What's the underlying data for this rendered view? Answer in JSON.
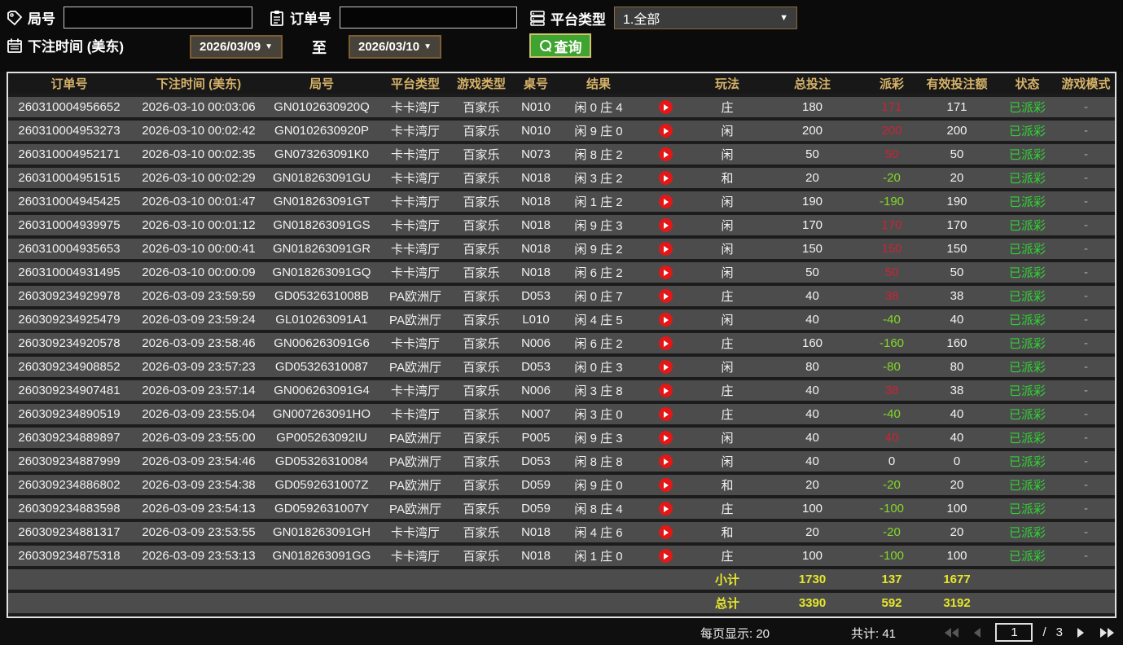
{
  "filters": {
    "round_label": "局号",
    "order_label": "订单号",
    "platform_label": "平台类型",
    "platform_value": "1.全部",
    "bet_time_label": "下注时间 (美东)",
    "date_from": "2026/03/09",
    "to_label": "至",
    "date_to": "2026/03/10",
    "search_label": "查询",
    "round_input_value": "",
    "order_input_value": ""
  },
  "icons": {
    "dropdown_arrow": "▼"
  },
  "table": {
    "columns": [
      "订单号",
      "下注时间 (美东)",
      "局号",
      "平台类型",
      "游戏类型",
      "桌号",
      "结果",
      "玩法",
      "总投注",
      "派彩",
      "有效投注额",
      "状态",
      "游戏模式"
    ],
    "rows": [
      {
        "order": "260310004956652",
        "time": "2026-03-10 00:03:06",
        "round": "GN0102630920Q",
        "platform": "卡卡湾厅",
        "game": "百家乐",
        "table": "N010",
        "result": "闲 0 庄 4",
        "play": "庄",
        "bet": "180",
        "payout": "171",
        "payout_class": "pos",
        "valid": "171",
        "status": "已派彩",
        "mode": "-"
      },
      {
        "order": "260310004953273",
        "time": "2026-03-10 00:02:42",
        "round": "GN0102630920P",
        "platform": "卡卡湾厅",
        "game": "百家乐",
        "table": "N010",
        "result": "闲 9 庄 0",
        "play": "闲",
        "bet": "200",
        "payout": "200",
        "payout_class": "pos",
        "valid": "200",
        "status": "已派彩",
        "mode": "-"
      },
      {
        "order": "260310004952171",
        "time": "2026-03-10 00:02:35",
        "round": "GN073263091K0",
        "platform": "卡卡湾厅",
        "game": "百家乐",
        "table": "N073",
        "result": "闲 8 庄 2",
        "play": "闲",
        "bet": "50",
        "payout": "50",
        "payout_class": "pos",
        "valid": "50",
        "status": "已派彩",
        "mode": "-"
      },
      {
        "order": "260310004951515",
        "time": "2026-03-10 00:02:29",
        "round": "GN018263091GU",
        "platform": "卡卡湾厅",
        "game": "百家乐",
        "table": "N018",
        "result": "闲 3 庄 2",
        "play": "和",
        "bet": "20",
        "payout": "-20",
        "payout_class": "neg",
        "valid": "20",
        "status": "已派彩",
        "mode": "-"
      },
      {
        "order": "260310004945425",
        "time": "2026-03-10 00:01:47",
        "round": "GN018263091GT",
        "platform": "卡卡湾厅",
        "game": "百家乐",
        "table": "N018",
        "result": "闲 1 庄 2",
        "play": "闲",
        "bet": "190",
        "payout": "-190",
        "payout_class": "neg",
        "valid": "190",
        "status": "已派彩",
        "mode": "-"
      },
      {
        "order": "260310004939975",
        "time": "2026-03-10 00:01:12",
        "round": "GN018263091GS",
        "platform": "卡卡湾厅",
        "game": "百家乐",
        "table": "N018",
        "result": "闲 9 庄 3",
        "play": "闲",
        "bet": "170",
        "payout": "170",
        "payout_class": "pos",
        "valid": "170",
        "status": "已派彩",
        "mode": "-"
      },
      {
        "order": "260310004935653",
        "time": "2026-03-10 00:00:41",
        "round": "GN018263091GR",
        "platform": "卡卡湾厅",
        "game": "百家乐",
        "table": "N018",
        "result": "闲 9 庄 2",
        "play": "闲",
        "bet": "150",
        "payout": "150",
        "payout_class": "pos",
        "valid": "150",
        "status": "已派彩",
        "mode": "-"
      },
      {
        "order": "260310004931495",
        "time": "2026-03-10 00:00:09",
        "round": "GN018263091GQ",
        "platform": "卡卡湾厅",
        "game": "百家乐",
        "table": "N018",
        "result": "闲 6 庄 2",
        "play": "闲",
        "bet": "50",
        "payout": "50",
        "payout_class": "pos",
        "valid": "50",
        "status": "已派彩",
        "mode": "-"
      },
      {
        "order": "260309234929978",
        "time": "2026-03-09 23:59:59",
        "round": "GD0532631008B",
        "platform": "PA欧洲厅",
        "game": "百家乐",
        "table": "D053",
        "result": "闲 0 庄 7",
        "play": "庄",
        "bet": "40",
        "payout": "38",
        "payout_class": "pos",
        "valid": "38",
        "status": "已派彩",
        "mode": "-"
      },
      {
        "order": "260309234925479",
        "time": "2026-03-09 23:59:24",
        "round": "GL010263091A1",
        "platform": "PA欧洲厅",
        "game": "百家乐",
        "table": "L010",
        "result": "闲 4 庄 5",
        "play": "闲",
        "bet": "40",
        "payout": "-40",
        "payout_class": "neg",
        "valid": "40",
        "status": "已派彩",
        "mode": "-"
      },
      {
        "order": "260309234920578",
        "time": "2026-03-09 23:58:46",
        "round": "GN006263091G6",
        "platform": "卡卡湾厅",
        "game": "百家乐",
        "table": "N006",
        "result": "闲 6 庄 2",
        "play": "庄",
        "bet": "160",
        "payout": "-160",
        "payout_class": "neg",
        "valid": "160",
        "status": "已派彩",
        "mode": "-"
      },
      {
        "order": "260309234908852",
        "time": "2026-03-09 23:57:23",
        "round": "GD05326310087",
        "platform": "PA欧洲厅",
        "game": "百家乐",
        "table": "D053",
        "result": "闲 0 庄 3",
        "play": "闲",
        "bet": "80",
        "payout": "-80",
        "payout_class": "neg",
        "valid": "80",
        "status": "已派彩",
        "mode": "-"
      },
      {
        "order": "260309234907481",
        "time": "2026-03-09 23:57:14",
        "round": "GN006263091G4",
        "platform": "卡卡湾厅",
        "game": "百家乐",
        "table": "N006",
        "result": "闲 3 庄 8",
        "play": "庄",
        "bet": "40",
        "payout": "38",
        "payout_class": "pos",
        "valid": "38",
        "status": "已派彩",
        "mode": "-"
      },
      {
        "order": "260309234890519",
        "time": "2026-03-09 23:55:04",
        "round": "GN007263091HO",
        "platform": "卡卡湾厅",
        "game": "百家乐",
        "table": "N007",
        "result": "闲 3 庄 0",
        "play": "庄",
        "bet": "40",
        "payout": "-40",
        "payout_class": "neg",
        "valid": "40",
        "status": "已派彩",
        "mode": "-"
      },
      {
        "order": "260309234889897",
        "time": "2026-03-09 23:55:00",
        "round": "GP005263092IU",
        "platform": "PA欧洲厅",
        "game": "百家乐",
        "table": "P005",
        "result": "闲 9 庄 3",
        "play": "闲",
        "bet": "40",
        "payout": "40",
        "payout_class": "pos",
        "valid": "40",
        "status": "已派彩",
        "mode": "-"
      },
      {
        "order": "260309234887999",
        "time": "2026-03-09 23:54:46",
        "round": "GD05326310084",
        "platform": "PA欧洲厅",
        "game": "百家乐",
        "table": "D053",
        "result": "闲 8 庄 8",
        "play": "闲",
        "bet": "40",
        "payout": "0",
        "payout_class": "zero",
        "valid": "0",
        "status": "已派彩",
        "mode": "-"
      },
      {
        "order": "260309234886802",
        "time": "2026-03-09 23:54:38",
        "round": "GD0592631007Z",
        "platform": "PA欧洲厅",
        "game": "百家乐",
        "table": "D059",
        "result": "闲 9 庄 0",
        "play": "和",
        "bet": "20",
        "payout": "-20",
        "payout_class": "neg",
        "valid": "20",
        "status": "已派彩",
        "mode": "-"
      },
      {
        "order": "260309234883598",
        "time": "2026-03-09 23:54:13",
        "round": "GD0592631007Y",
        "platform": "PA欧洲厅",
        "game": "百家乐",
        "table": "D059",
        "result": "闲 8 庄 4",
        "play": "庄",
        "bet": "100",
        "payout": "-100",
        "payout_class": "neg",
        "valid": "100",
        "status": "已派彩",
        "mode": "-"
      },
      {
        "order": "260309234881317",
        "time": "2026-03-09 23:53:55",
        "round": "GN018263091GH",
        "platform": "卡卡湾厅",
        "game": "百家乐",
        "table": "N018",
        "result": "闲 4 庄 6",
        "play": "和",
        "bet": "20",
        "payout": "-20",
        "payout_class": "neg",
        "valid": "20",
        "status": "已派彩",
        "mode": "-"
      },
      {
        "order": "260309234875318",
        "time": "2026-03-09 23:53:13",
        "round": "GN018263091GG",
        "platform": "卡卡湾厅",
        "game": "百家乐",
        "table": "N018",
        "result": "闲 1 庄 0",
        "play": "庄",
        "bet": "100",
        "payout": "-100",
        "payout_class": "neg",
        "valid": "100",
        "status": "已派彩",
        "mode": "-"
      }
    ],
    "subtotal": {
      "label": "小计",
      "bet": "1730",
      "payout": "137",
      "valid": "1677"
    },
    "total": {
      "label": "总计",
      "bet": "3390",
      "payout": "592",
      "valid": "3192"
    }
  },
  "pagination": {
    "per_page_label": "每页显示: 20",
    "total_label": "共计: 41",
    "current_page": "1",
    "separator": "/",
    "total_pages": "3"
  }
}
